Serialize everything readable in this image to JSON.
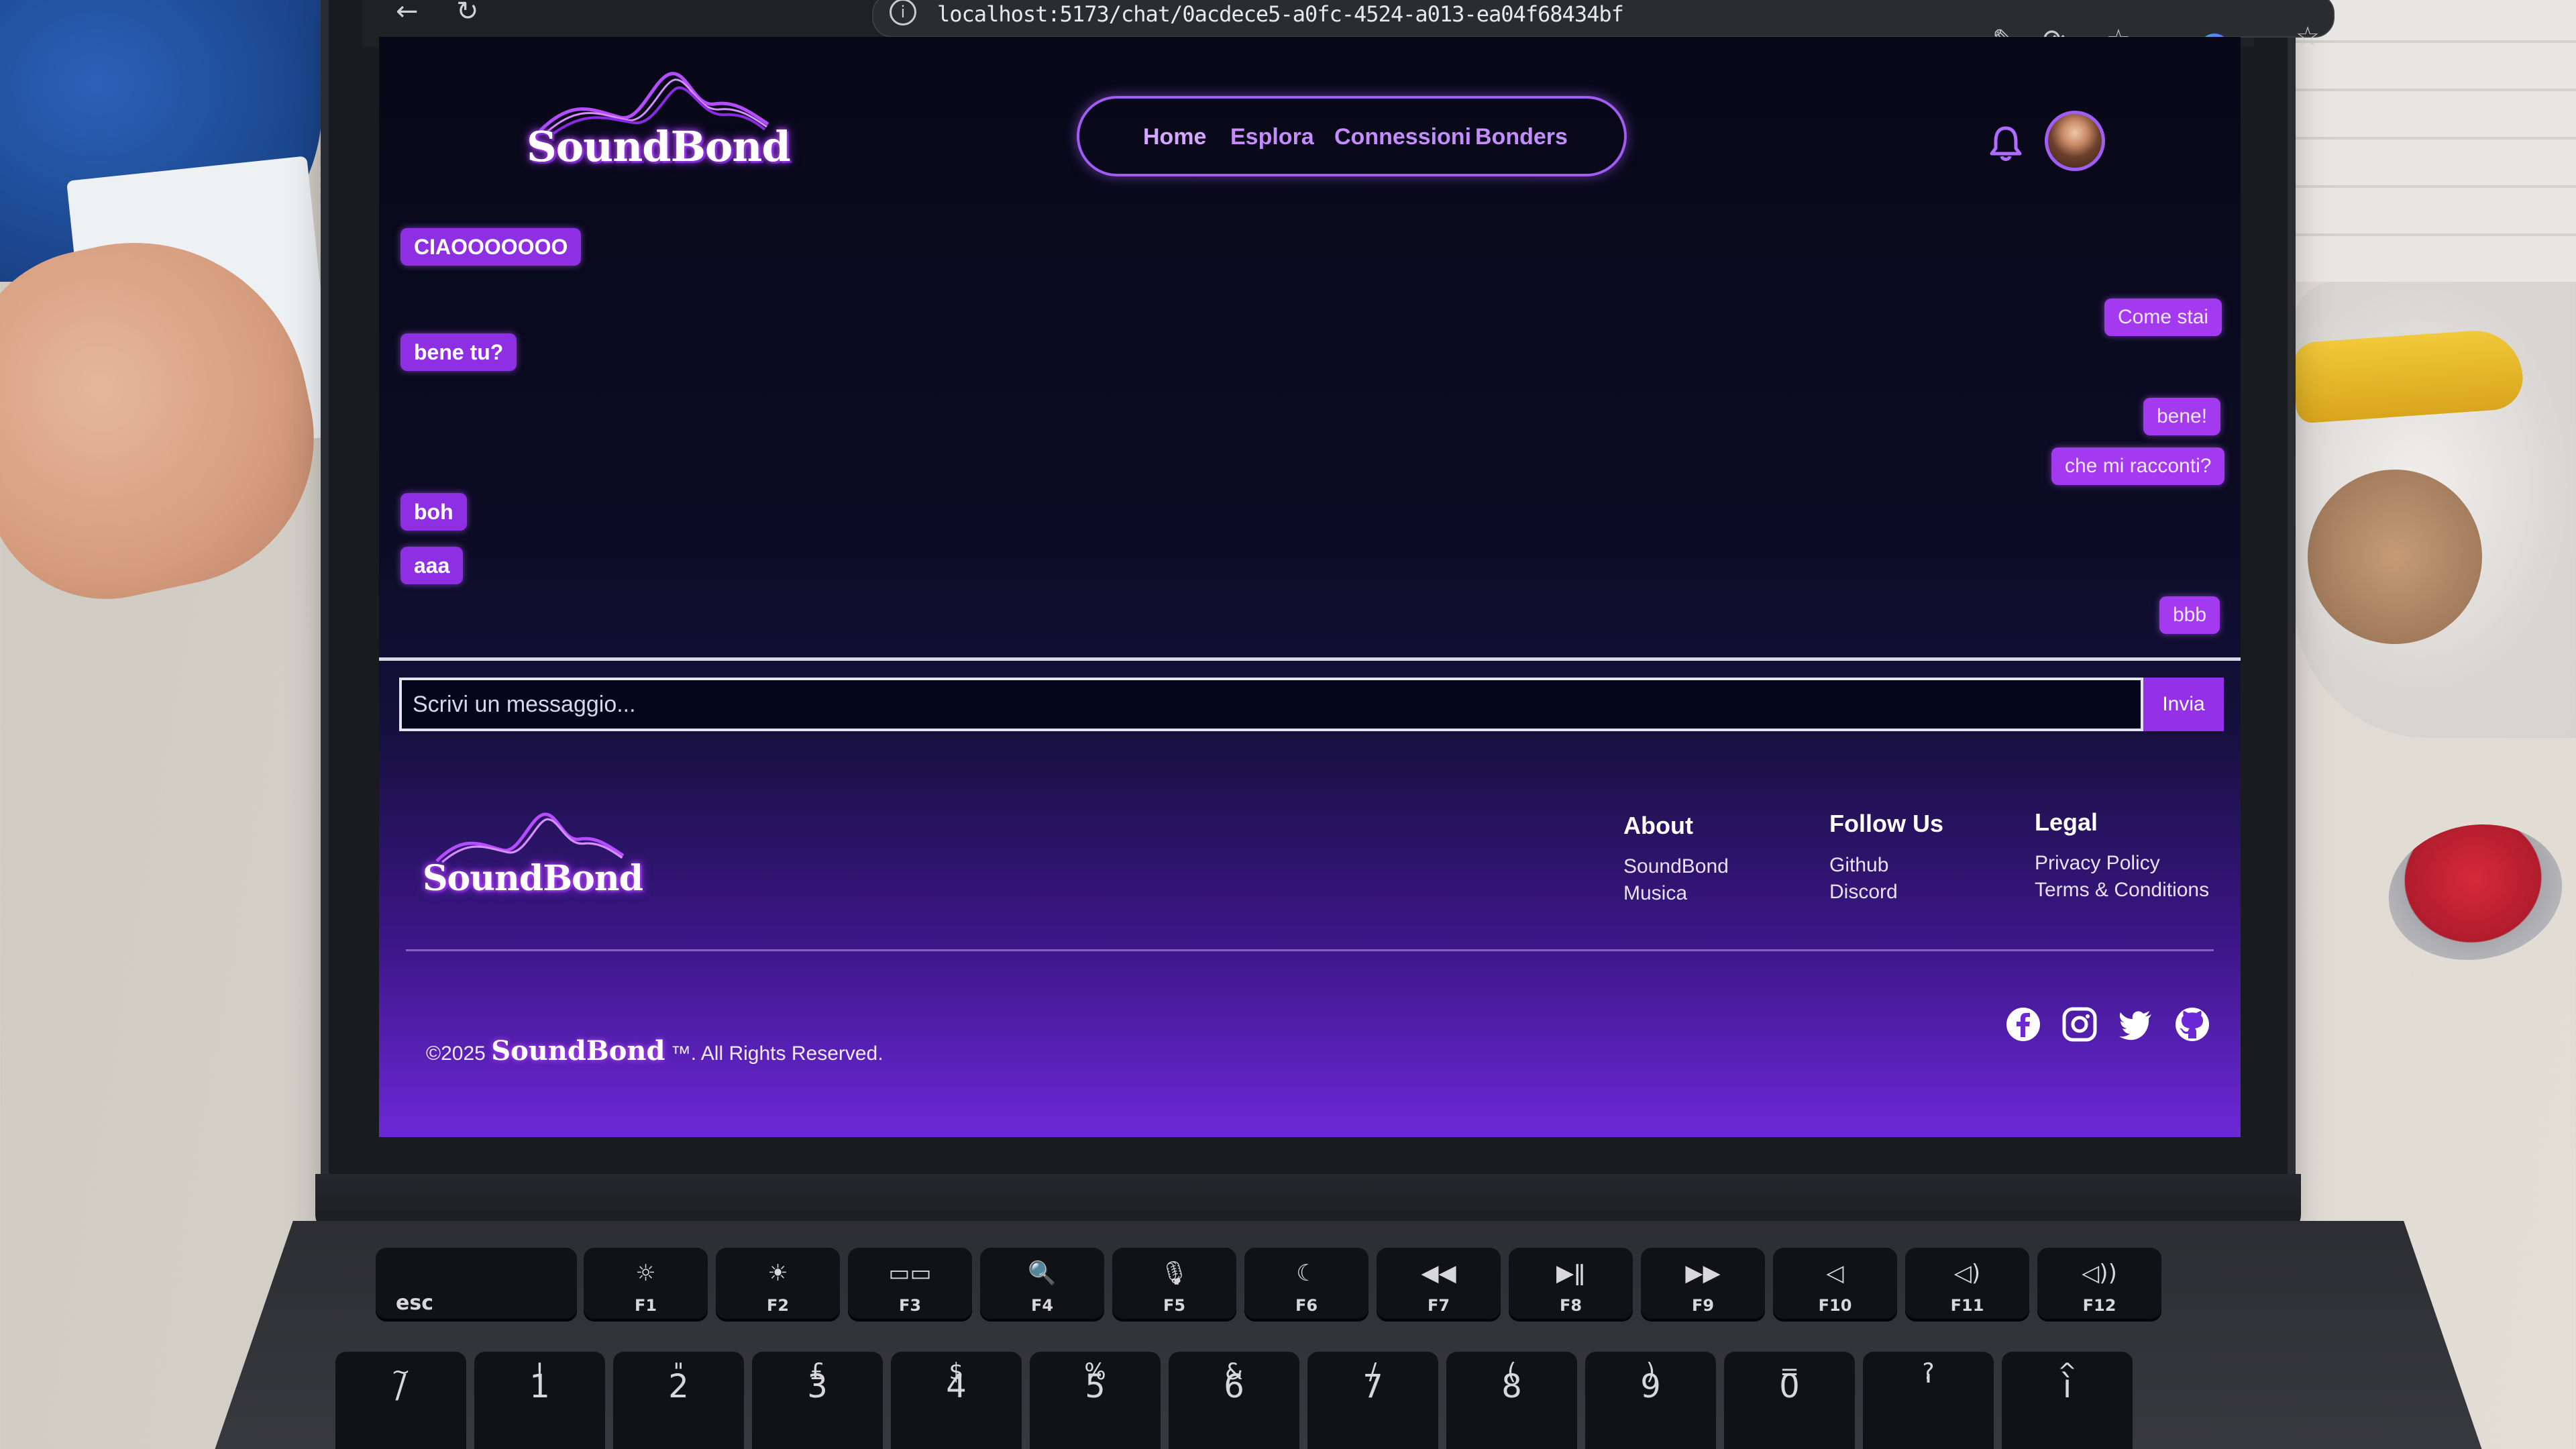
{
  "browser": {
    "url": "localhost:5173/chat/0acdece5-a0fc-4524-a013-ea04f68434bf",
    "info_icon": "info-icon",
    "back_icon": "back-arrow-icon",
    "reload_icon": "reload-icon",
    "star_icon": "star-icon"
  },
  "header": {
    "logo_text": "SoundBond",
    "nav": [
      {
        "label": "Home"
      },
      {
        "label": "Esplora"
      },
      {
        "label": "Connessioni"
      },
      {
        "label": "Bonders"
      }
    ],
    "bell_icon": "bell-icon",
    "avatar_icon": "avatar"
  },
  "chat": {
    "messages": [
      {
        "text": "CIAOOOOOOO",
        "side": "received"
      },
      {
        "text": "Come stai",
        "side": "sent"
      },
      {
        "text": "bene tu?",
        "side": "received"
      },
      {
        "text": "bene!",
        "side": "sent"
      },
      {
        "text": "che mi racconti?",
        "side": "sent"
      },
      {
        "text": "boh",
        "side": "received"
      },
      {
        "text": "aaa",
        "side": "received"
      },
      {
        "text": "bbb",
        "side": "sent"
      }
    ],
    "input_placeholder": "Scrivi un messaggio...",
    "send_label": "Invia"
  },
  "footer": {
    "logo_text": "SoundBond",
    "columns": [
      {
        "title": "About",
        "links": [
          "SoundBond",
          "Musica"
        ]
      },
      {
        "title": "Follow Us",
        "links": [
          "Github",
          "Discord"
        ]
      },
      {
        "title": "Legal",
        "links": [
          "Privacy Policy",
          "Terms & Conditions"
        ]
      }
    ],
    "copyright_prefix": "©2025",
    "copyright_brand": "SoundBond",
    "copyright_suffix": "™. All Rights Reserved.",
    "social_icons": [
      "facebook-icon",
      "instagram-icon",
      "twitter-icon",
      "github-icon"
    ]
  },
  "keyboard": {
    "fn_row": [
      {
        "icon": "",
        "label": "esc"
      },
      {
        "icon": "☼",
        "label": "F1"
      },
      {
        "icon": "☀",
        "label": "F2"
      },
      {
        "icon": "▭▭",
        "label": "F3"
      },
      {
        "icon": "🔍",
        "label": "F4"
      },
      {
        "icon": "🎙",
        "label": "F5"
      },
      {
        "icon": "☾",
        "label": "F6"
      },
      {
        "icon": "◀◀",
        "label": "F7"
      },
      {
        "icon": "▶ǁ",
        "label": "F8"
      },
      {
        "icon": "▶▶",
        "label": "F9"
      },
      {
        "icon": "◁",
        "label": "F10"
      },
      {
        "icon": "◁)",
        "label": "F11"
      },
      {
        "icon": "◁))",
        "label": "F12"
      }
    ],
    "num_row": [
      {
        "top": "~",
        "bottom": "/"
      },
      {
        "top": "!",
        "bottom": "1"
      },
      {
        "top": "\"",
        "bottom": "2"
      },
      {
        "top": "£",
        "bottom": "3"
      },
      {
        "top": "$",
        "bottom": "4"
      },
      {
        "top": "%",
        "bottom": "5"
      },
      {
        "top": "&",
        "bottom": "6"
      },
      {
        "top": "/",
        "bottom": "7"
      },
      {
        "top": "(",
        "bottom": "8"
      },
      {
        "top": ")",
        "bottom": "9"
      },
      {
        "top": "=",
        "bottom": "0"
      },
      {
        "top": "?",
        "bottom": "'"
      },
      {
        "top": "^",
        "bottom": "ì"
      }
    ]
  },
  "colors": {
    "accent": "#8a2be2",
    "nav_link": "#c58cff",
    "page_bg_top": "#080818",
    "page_bg_bottom": "#6c28d6"
  }
}
